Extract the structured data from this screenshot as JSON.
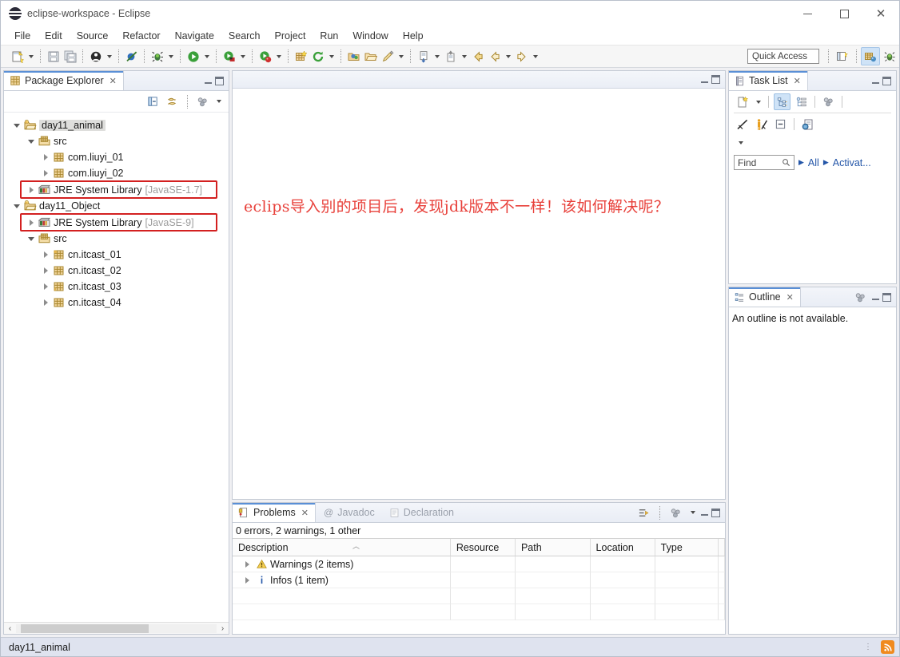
{
  "window": {
    "title": "eclipse-workspace - Eclipse",
    "app_icon": "eclipse-icon",
    "minimize": "−",
    "maximize": "□",
    "close": "✕"
  },
  "menubar": {
    "items": [
      {
        "label": "File"
      },
      {
        "label": "Edit"
      },
      {
        "label": "Source"
      },
      {
        "label": "Refactor"
      },
      {
        "label": "Navigate"
      },
      {
        "label": "Search"
      },
      {
        "label": "Project"
      },
      {
        "label": "Run"
      },
      {
        "label": "Window"
      },
      {
        "label": "Help"
      }
    ]
  },
  "toolbar": {
    "quick_access_placeholder": "Quick Access",
    "buttons": [
      {
        "name": "new-wizard",
        "glyph": "📄"
      },
      {
        "name": "save",
        "glyph": "💾"
      },
      {
        "name": "save-all",
        "glyph": "🗐"
      },
      {
        "name": "new-java-class",
        "glyph": "●"
      },
      {
        "name": "skip-breakpoints",
        "glyph": "⦸"
      },
      {
        "name": "debug",
        "glyph": "🐞"
      },
      {
        "name": "run",
        "glyph": "▶"
      },
      {
        "name": "run-external-tools",
        "glyph": "◉"
      },
      {
        "name": "coverage",
        "glyph": "◎"
      },
      {
        "name": "new-java-project",
        "glyph": "⊞"
      },
      {
        "name": "refresh",
        "glyph": "↻"
      },
      {
        "name": "open-type",
        "glyph": "📦"
      },
      {
        "name": "open-task",
        "glyph": "📂"
      },
      {
        "name": "search",
        "glyph": "🖊"
      },
      {
        "name": "next-annotation",
        "glyph": "⇩"
      },
      {
        "name": "previous-edit",
        "glyph": "⇧"
      },
      {
        "name": "back",
        "glyph": "⬅"
      },
      {
        "name": "back-history",
        "glyph": "⬅"
      },
      {
        "name": "forward",
        "glyph": "➡"
      }
    ],
    "perspective_new": "open-perspective-icon",
    "perspective_java": "java-perspective-icon",
    "perspective_debug": "debug-perspective-icon"
  },
  "package_explorer": {
    "tab_label": "Package Explorer",
    "tab_close": "✕",
    "toolbar": [
      {
        "name": "collapse-all-icon"
      },
      {
        "name": "link-with-editor-icon"
      },
      {
        "name": "view-menu-icon"
      },
      {
        "name": "view-dropdown-icon"
      }
    ],
    "minimize": "minimize-icon",
    "maximize": "maximize-icon",
    "tree": [
      {
        "label": "day11_animal",
        "indent": 0,
        "twist": "down",
        "icon": "java-project-icon",
        "selected": true,
        "sub": "",
        "boxed": false
      },
      {
        "label": "src",
        "indent": 1,
        "twist": "down",
        "icon": "source-folder-icon",
        "sub": "",
        "boxed": false
      },
      {
        "label": "com.liuyi_01",
        "indent": 2,
        "twist": "right",
        "icon": "package-icon",
        "sub": "",
        "boxed": false
      },
      {
        "label": "com.liuyi_02",
        "indent": 2,
        "twist": "right",
        "icon": "package-icon",
        "sub": "",
        "boxed": false
      },
      {
        "label": "JRE System Library",
        "indent": 1,
        "twist": "right",
        "icon": "jre-library-icon",
        "sub": "[JavaSE-1.7]",
        "boxed": true
      },
      {
        "label": "day11_Object",
        "indent": 0,
        "twist": "down",
        "icon": "java-project-icon",
        "sub": "",
        "boxed": false
      },
      {
        "label": "JRE System Library",
        "indent": 1,
        "twist": "right",
        "icon": "jre-library-icon",
        "sub": "[JavaSE-9]",
        "boxed": true
      },
      {
        "label": "src",
        "indent": 1,
        "twist": "down",
        "icon": "source-folder-icon",
        "sub": "",
        "boxed": false
      },
      {
        "label": "cn.itcast_01",
        "indent": 2,
        "twist": "right",
        "icon": "package-icon",
        "sub": "",
        "boxed": false
      },
      {
        "label": "cn.itcast_02",
        "indent": 2,
        "twist": "right",
        "icon": "package-icon",
        "sub": "",
        "boxed": false
      },
      {
        "label": "cn.itcast_03",
        "indent": 2,
        "twist": "right",
        "icon": "package-icon",
        "sub": "",
        "boxed": false
      },
      {
        "label": "cn.itcast_04",
        "indent": 2,
        "twist": "right",
        "icon": "package-icon",
        "sub": "",
        "boxed": false
      }
    ],
    "scroll_left": "‹",
    "scroll_right": "›"
  },
  "editor": {
    "note_text": "eclips导入别的项目后，发现jdk版本不一样！该如何解决呢？",
    "note_color": "#e8403a",
    "minimize": "minimize-icon",
    "maximize": "maximize-icon"
  },
  "problems": {
    "tabs": [
      {
        "label": "Problems",
        "active": true,
        "icon": "problems-icon",
        "close": "✕"
      },
      {
        "label": "Javadoc",
        "active": false,
        "icon": "javadoc-icon"
      },
      {
        "label": "Declaration",
        "active": false,
        "icon": "declaration-icon"
      }
    ],
    "summary": "0 errors, 2 warnings, 1 other",
    "columns": [
      "Description",
      "Resource",
      "Path",
      "Location",
      "Type"
    ],
    "rows": [
      {
        "twist": "right",
        "icon": "warning-icon",
        "description": "Warnings (2 items)",
        "resource": "",
        "path": "",
        "location": "",
        "type": ""
      },
      {
        "twist": "right",
        "icon": "info-icon",
        "description": "Infos (1 item)",
        "resource": "",
        "path": "",
        "location": "",
        "type": ""
      }
    ],
    "toolbar": [
      {
        "name": "focus-on-selection-icon"
      },
      {
        "name": "view-menu-icon"
      },
      {
        "name": "view-dropdown-icon"
      }
    ]
  },
  "task_list": {
    "tab_label": "Task List",
    "tab_close": "✕",
    "toolbar_row1": [
      {
        "name": "new-task-icon"
      },
      {
        "name": "new-task-dropdown-icon"
      },
      {
        "name": "categorized-presentation-icon"
      },
      {
        "name": "scheduled-presentation-icon"
      },
      {
        "name": "view-menu-icon"
      }
    ],
    "toolbar_row2": [
      {
        "name": "focus-on-workweek-icon"
      },
      {
        "name": "synchronize-changed-icon"
      },
      {
        "name": "collapse-all-icon"
      },
      {
        "name": "open-repository-task-icon"
      }
    ],
    "expand_caret": "view-dropdown-icon",
    "find_placeholder": "Find",
    "find_icon": "search-icon",
    "filter_all": "All",
    "filter_activate": "Activat...",
    "minimize": "minimize-icon",
    "maximize": "maximize-icon"
  },
  "outline": {
    "tab_label": "Outline",
    "tab_close": "✕",
    "message": "An outline is not available.",
    "view_menu": "view-menu-icon",
    "minimize": "minimize-icon",
    "maximize": "maximize-icon"
  },
  "statusbar": {
    "text": "day11_animal",
    "grip": "⣿",
    "rss_icon": "rss-feed-icon"
  }
}
